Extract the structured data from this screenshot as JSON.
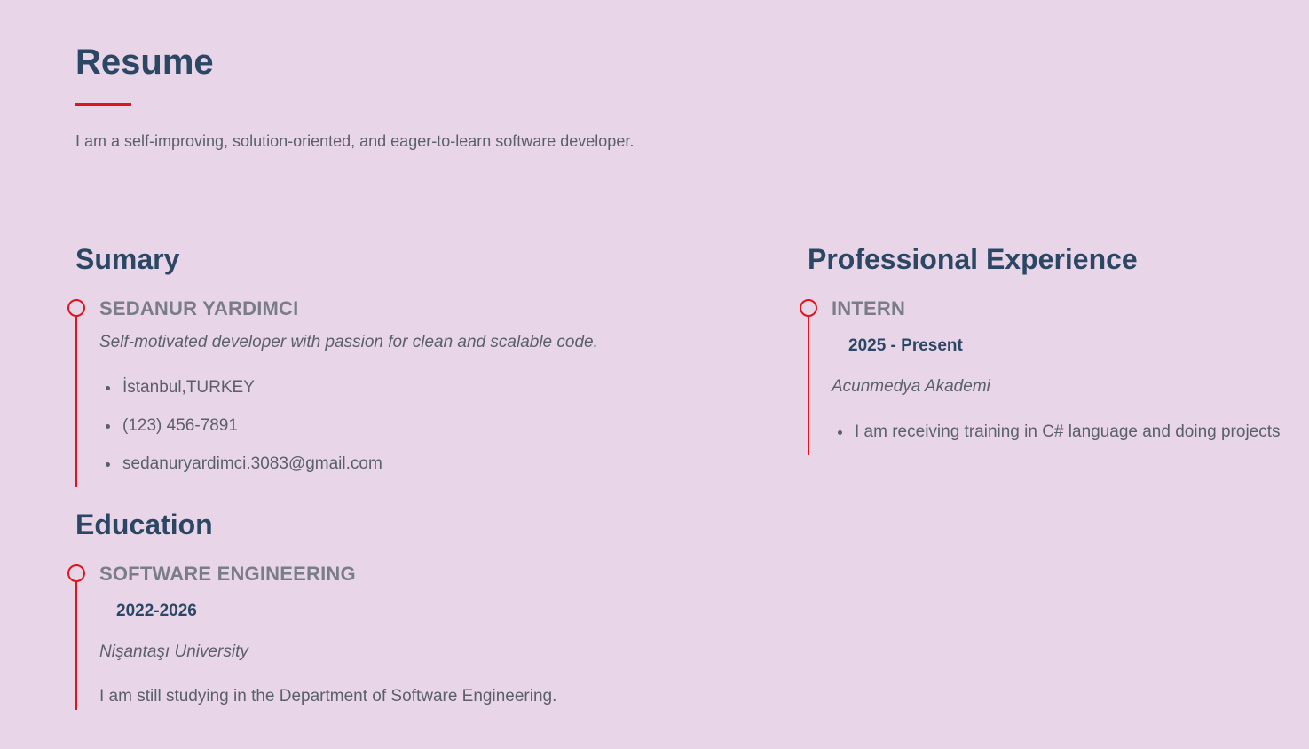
{
  "header": {
    "title": "Resume",
    "intro": "I am a self-improving, solution-oriented, and eager-to-learn software developer."
  },
  "summary": {
    "heading": "Sumary",
    "name": "SEDANUR YARDIMCI",
    "tagline": "Self-motivated developer with passion for clean and scalable code.",
    "contacts": [
      "İstanbul,TURKEY",
      "(123) 456-7891",
      "sedanuryardimci.3083@gmail.com"
    ]
  },
  "education": {
    "heading": "Education",
    "degree": "SOFTWARE ENGINEERING",
    "years": "2022-2026",
    "school": "Nişantaşı University",
    "description": "I am still studying in the Department of Software Engineering."
  },
  "experience": {
    "heading": "Professional Experience",
    "role": "INTERN",
    "period": "2025 - Present",
    "company": "Acunmedya Akademi",
    "duties": [
      "I am receiving training in C# language and doing projects"
    ]
  },
  "colors": {
    "background": "#e8d6e8",
    "heading": "#2c4764",
    "accent": "#e0151b",
    "text": "#5a5f6b"
  }
}
